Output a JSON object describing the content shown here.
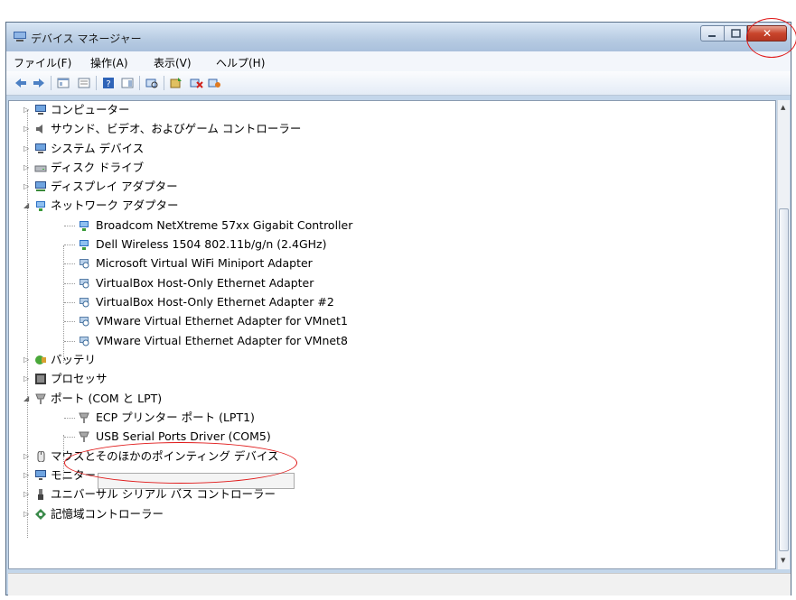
{
  "window": {
    "title": "デバイス マネージャー",
    "close_label": "✕"
  },
  "menubar": [
    {
      "label": "ファイル(F)"
    },
    {
      "label": "操作(A)"
    },
    {
      "label": "表示(V)"
    },
    {
      "label": "ヘルプ(H)"
    }
  ],
  "toolbar": {
    "icons": [
      "back-icon",
      "forward-icon",
      "console-tree-icon",
      "properties-icon",
      "help-icon",
      "action-pane-icon",
      "scan-hardware-icon",
      "update-driver-icon",
      "uninstall-icon",
      "disable-icon"
    ]
  },
  "tree": {
    "items": [
      {
        "label": "コンピューター",
        "expanded": false,
        "icon": "computer-icon"
      },
      {
        "label": "サウンド、ビデオ、およびゲーム コントローラー",
        "expanded": false,
        "icon": "speaker-icon"
      },
      {
        "label": "システム デバイス",
        "expanded": false,
        "icon": "system-device-icon"
      },
      {
        "label": "ディスク ドライブ",
        "expanded": false,
        "icon": "disk-drive-icon"
      },
      {
        "label": "ディスプレイ アダプター",
        "expanded": false,
        "icon": "display-adapter-icon"
      },
      {
        "label": "ネットワーク アダプター",
        "expanded": true,
        "icon": "network-adapter-icon",
        "children": [
          {
            "label": "Broadcom NetXtreme 57xx Gigabit Controller",
            "icon": "network-card-icon"
          },
          {
            "label": "Dell Wireless 1504 802.11b/g/n (2.4GHz)",
            "icon": "network-card-icon"
          },
          {
            "label": "Microsoft Virtual WiFi Miniport Adapter",
            "icon": "virtual-adapter-icon"
          },
          {
            "label": "VirtualBox Host-Only Ethernet Adapter",
            "icon": "virtual-adapter-icon"
          },
          {
            "label": "VirtualBox Host-Only Ethernet Adapter #2",
            "icon": "virtual-adapter-icon"
          },
          {
            "label": "VMware Virtual Ethernet Adapter for VMnet1",
            "icon": "virtual-adapter-icon"
          },
          {
            "label": "VMware Virtual Ethernet Adapter for VMnet8",
            "icon": "virtual-adapter-icon"
          }
        ]
      },
      {
        "label": "バッテリ",
        "expanded": false,
        "icon": "battery-icon"
      },
      {
        "label": "プロセッサ",
        "expanded": false,
        "icon": "processor-icon"
      },
      {
        "label": "ポート (COM と LPT)",
        "expanded": true,
        "icon": "port-icon",
        "children": [
          {
            "label": "ECP プリンター ポート (LPT1)",
            "icon": "port-icon"
          },
          {
            "label": "USB Serial Ports Driver (COM5)",
            "icon": "port-icon",
            "selected": true
          }
        ]
      },
      {
        "label": "マウスとそのほかのポインティング デバイス",
        "expanded": false,
        "icon": "mouse-icon"
      },
      {
        "label": "モニター",
        "expanded": false,
        "icon": "monitor-icon"
      },
      {
        "label": "ユニバーサル シリアル バス コントローラー",
        "expanded": false,
        "icon": "usb-controller-icon"
      },
      {
        "label": "記憶域コントローラー",
        "expanded": false,
        "icon": "storage-controller-icon"
      }
    ]
  },
  "colors": {
    "highlight_circle": "#e01818",
    "title_bar": "#b7cbe2",
    "close_button": "#c9452c"
  }
}
